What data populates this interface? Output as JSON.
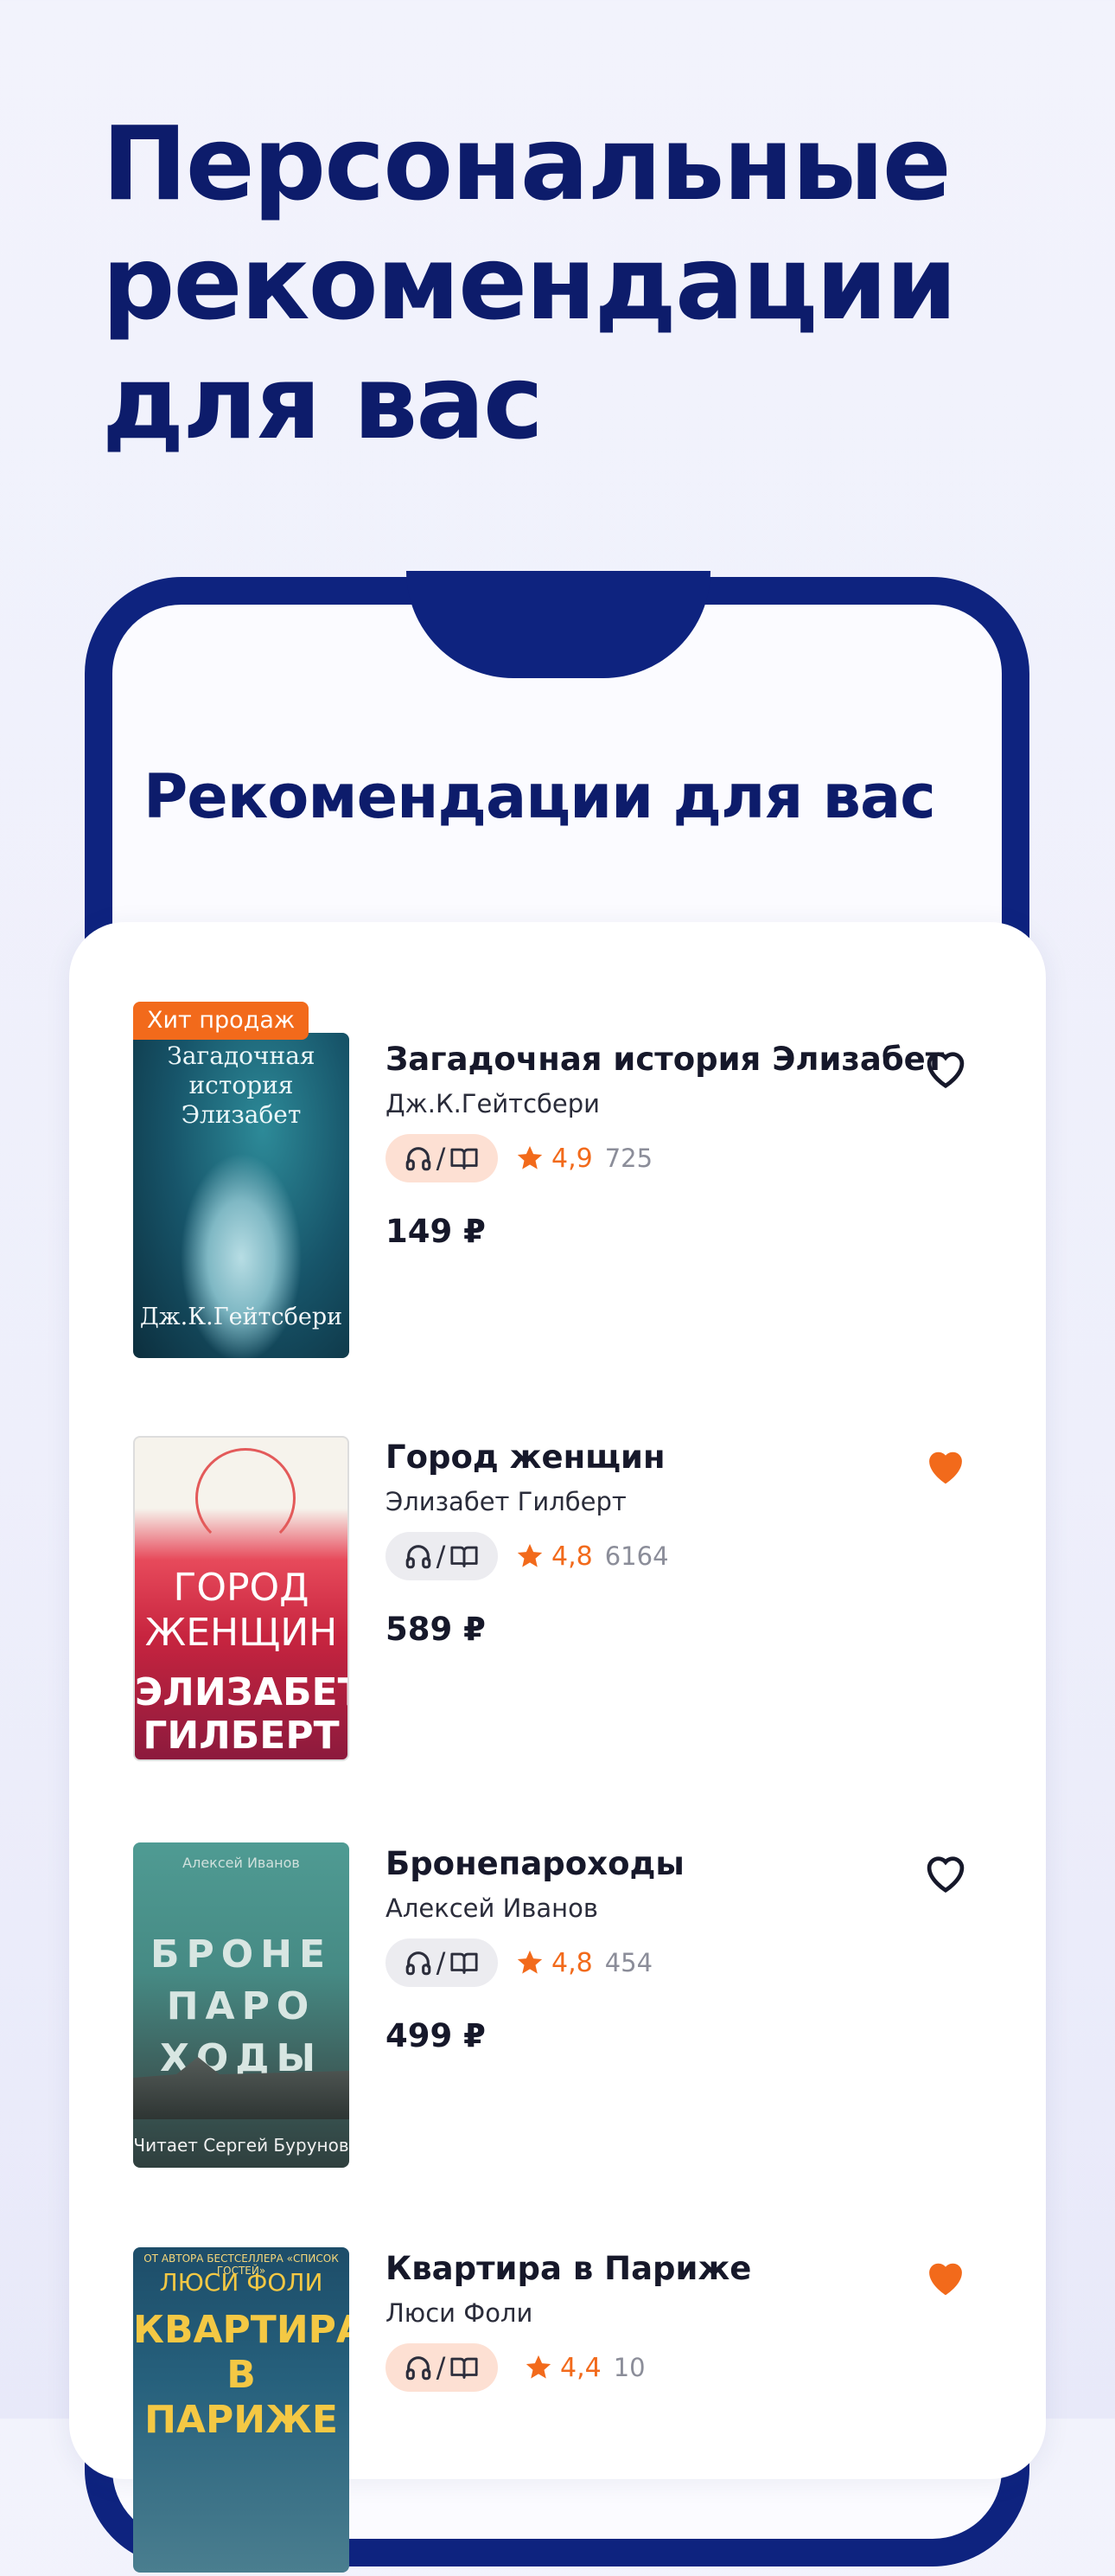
{
  "headline": {
    "lines": [
      "Персональные",
      "рекомендации",
      "для вас"
    ]
  },
  "screen_title": "Рекомендации для вас",
  "colors": {
    "navy": "#0e237f",
    "accent": "#f26a1b",
    "badge": "#f26a1b"
  },
  "books": [
    {
      "badge": "Хит продаж",
      "title": "Загадочная история Элизабет",
      "author": "Дж.К.Гейтсбери",
      "format_icons": [
        "headphones-icon",
        "book-icon"
      ],
      "format_separator": "/",
      "rating": "4,9",
      "reviews": "725",
      "price": "149 ₽",
      "favorited": false,
      "cover": {
        "title_lines": [
          "Загадочная",
          "история Элизабет"
        ],
        "author": "Дж.К.Гейтсбери"
      }
    },
    {
      "title": "Город женщин",
      "author": "Элизабет Гилберт",
      "format_icons": [
        "headphones-icon",
        "book-icon"
      ],
      "format_separator": "/",
      "rating": "4,8",
      "reviews": "6164",
      "price": "589 ₽",
      "favorited": true,
      "cover": {
        "title_lines": [
          "ГОРОД",
          "ЖЕНЩИН"
        ],
        "author_lines": [
          "ЭЛИЗАБЕТ",
          "ГИЛБЕРТ"
        ]
      }
    },
    {
      "title": "Бронепароходы",
      "author": "Алексей Иванов",
      "format_icons": [
        "headphones-icon",
        "book-icon"
      ],
      "format_separator": "/",
      "rating": "4,8",
      "reviews": "454",
      "price": "499 ₽",
      "favorited": false,
      "cover": {
        "top": "Алексей Иванов",
        "title_lines": [
          "БРОНЕ",
          "ПАРО",
          "ХОДЫ"
        ],
        "narrator": "Читает Сергей Бурунов"
      }
    },
    {
      "title": "Квартира в Париже",
      "author": "Люси Фоли",
      "format_icons": [
        "headphones-icon",
        "book-icon"
      ],
      "format_separator": "/",
      "rating": "4,4",
      "reviews": "10",
      "favorited": true,
      "cover": {
        "top": "ОТ АВТОРА БЕСТСЕЛЛЕРА «СПИСОК ГОСТЕЙ»",
        "author": "ЛЮСИ ФОЛИ",
        "title_lines": [
          "КВАРТИРА",
          "В ПАРИЖЕ"
        ]
      }
    }
  ]
}
